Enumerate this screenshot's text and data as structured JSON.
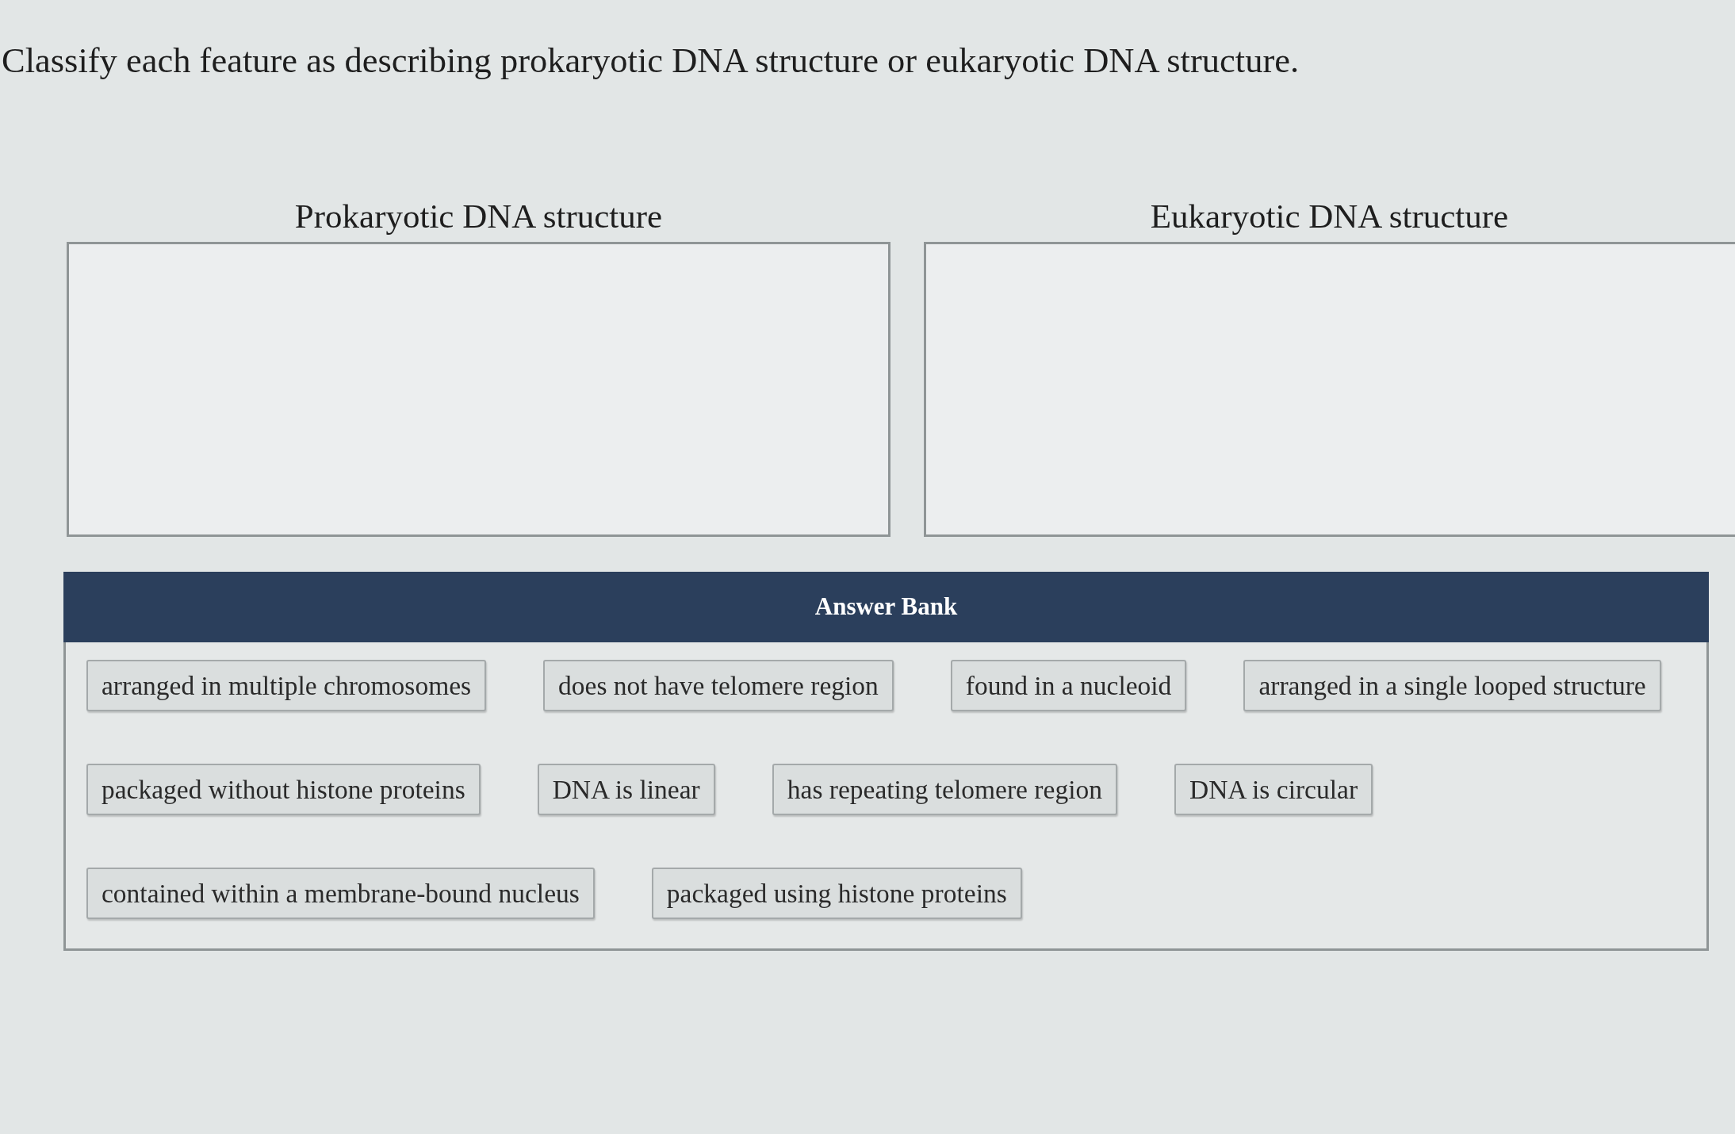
{
  "instruction": "Classify each feature as describing prokaryotic DNA structure or eukaryotic DNA structure.",
  "categories": [
    {
      "title": "Prokaryotic DNA structure"
    },
    {
      "title": "Eukaryotic DNA structure"
    }
  ],
  "answer_bank": {
    "title": "Answer Bank",
    "rows": [
      {
        "items": [
          "arranged in multiple chromosomes",
          "does not have telomere region",
          "found in a nucleoid",
          "arranged in a single looped structure"
        ]
      },
      {
        "items": [
          "packaged without histone proteins",
          "DNA is linear",
          "has repeating telomere region",
          "DNA is circular"
        ]
      },
      {
        "items": [
          "contained within a membrane-bound nucleus",
          "packaged using histone proteins"
        ]
      }
    ]
  }
}
